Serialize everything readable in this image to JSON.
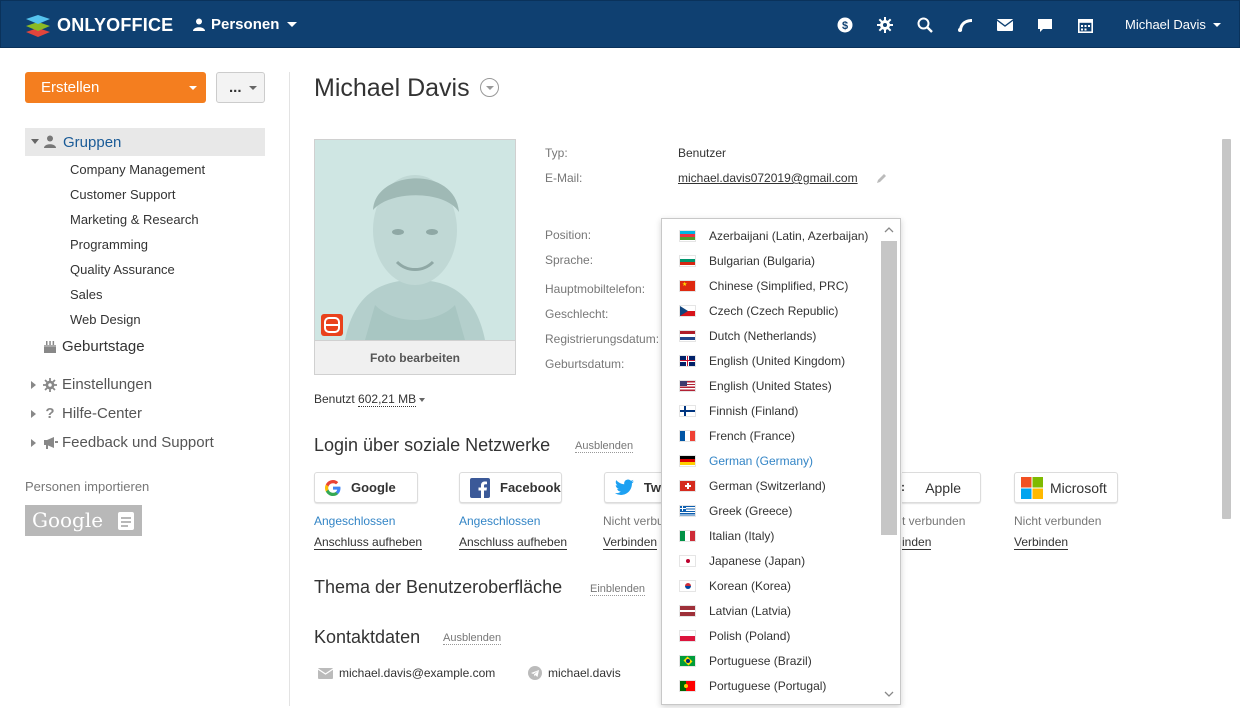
{
  "brand": {
    "name": "ONLYOFFICE"
  },
  "header": {
    "module": "Personen",
    "user": "Michael Davis",
    "icons": [
      "dollar-icon",
      "gear-icon",
      "search-icon",
      "feed-icon",
      "mail-icon",
      "chat-icon",
      "calendar-icon"
    ]
  },
  "sidebar": {
    "create_label": "Erstellen",
    "more_label": "...",
    "groups_label": "Gruppen",
    "groups": [
      "Company Management",
      "Customer Support",
      "Marketing & Research",
      "Programming",
      "Quality Assurance",
      "Sales",
      "Web Design"
    ],
    "birthdays_label": "Geburtstage",
    "settings_label": "Einstellungen",
    "help_label": "Hilfe-Center",
    "feedback_label": "Feedback und Support",
    "import_label": "Personen importieren",
    "import_google": "Google"
  },
  "profile": {
    "name": "Michael Davis",
    "edit_photo": "Foto bearbeiten",
    "quota_prefix": "Benutzt",
    "quota_value": "602,21 MB",
    "fields": {
      "type_label": "Typ:",
      "type_value": "Benutzer",
      "email_label": "E-Mail:",
      "email_value": "michael.davis072019@gmail.com",
      "position_label": "Position:",
      "language_label": "Sprache:",
      "mobile_label": "Hauptmobiltelefon:",
      "gender_label": "Geschlecht:",
      "registration_label": "Registrierungsdatum:",
      "birthday_label": "Geburtsdatum:"
    }
  },
  "social": {
    "title": "Login über soziale Netzwerke",
    "toggle": "Ausblenden",
    "providers": [
      {
        "name": "Google",
        "status": "Angeschlossen",
        "action": "Anschluss aufheben"
      },
      {
        "name": "Facebook",
        "status": "Angeschlossen",
        "action": "Anschluss aufheben"
      },
      {
        "name": "Tw",
        "status": "Nicht verbu",
        "action": "Verbinden"
      },
      {
        "name": "Apple",
        "status": "t verbunden",
        "action": "inden"
      },
      {
        "name": "Microsoft",
        "status": "Nicht verbunden",
        "action": "Verbinden"
      }
    ],
    "colors": {
      "connected": "#3385c6",
      "not_connected": "#777777"
    }
  },
  "theme": {
    "title": "Thema der Benutzeroberfläche",
    "toggle": "Einblenden"
  },
  "contacts": {
    "title": "Kontaktdaten",
    "toggle": "Ausblenden",
    "email": "michael.davis@example.com",
    "telegram": "michael.davis"
  },
  "languages": {
    "selected": "German (Germany)",
    "items": [
      {
        "label": "Azerbaijani (Latin, Azerbaijan)",
        "flag": "az"
      },
      {
        "label": "Bulgarian (Bulgaria)",
        "flag": "bg"
      },
      {
        "label": "Chinese (Simplified, PRC)",
        "flag": "cn"
      },
      {
        "label": "Czech (Czech Republic)",
        "flag": "cz"
      },
      {
        "label": "Dutch (Netherlands)",
        "flag": "nl"
      },
      {
        "label": "English (United Kingdom)",
        "flag": "gb"
      },
      {
        "label": "English (United States)",
        "flag": "us"
      },
      {
        "label": "Finnish (Finland)",
        "flag": "fi"
      },
      {
        "label": "French (France)",
        "flag": "fr"
      },
      {
        "label": "German (Germany)",
        "flag": "de"
      },
      {
        "label": "German (Switzerland)",
        "flag": "ch"
      },
      {
        "label": "Greek (Greece)",
        "flag": "gr"
      },
      {
        "label": "Italian (Italy)",
        "flag": "it"
      },
      {
        "label": "Japanese (Japan)",
        "flag": "jp"
      },
      {
        "label": "Korean (Korea)",
        "flag": "kr"
      },
      {
        "label": "Latvian (Latvia)",
        "flag": "lv"
      },
      {
        "label": "Polish (Poland)",
        "flag": "pl"
      },
      {
        "label": "Portuguese (Brazil)",
        "flag": "br"
      },
      {
        "label": "Portuguese (Portugal)",
        "flag": "pt"
      }
    ]
  },
  "colors": {
    "header": "#0f4071",
    "accent": "#f47e1f",
    "link": "#1a5b97",
    "selected": "#3385c6"
  }
}
